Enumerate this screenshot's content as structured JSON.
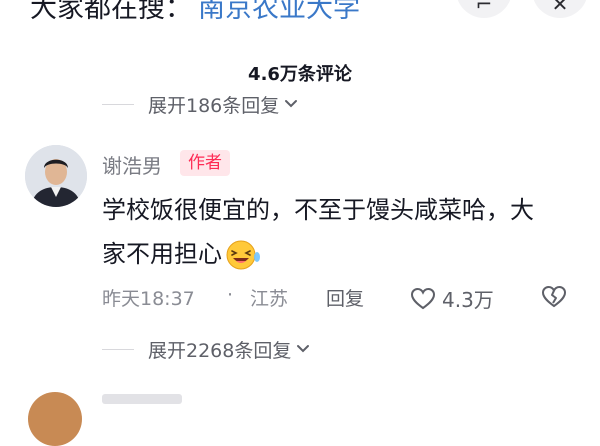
{
  "search_bar": {
    "prefix": "大家都在搜：",
    "keyword": "南京农业大学",
    "action_icon_1": "share-icon",
    "action_icon_2": "close-icon"
  },
  "comments_header": {
    "count_label": "4.6万条评论"
  },
  "expand_previous": {
    "label": "展开186条回复"
  },
  "comment": {
    "author": "谢浩男",
    "badge": "作者",
    "text": "学校饭很便宜的，不至于馒头咸菜哈，大家不用担心",
    "time": "昨天18:37",
    "separator": "·",
    "location": "江苏",
    "reply_label": "回复",
    "like_count": "4.3万",
    "emoji": "laughing-face-icon"
  },
  "expand_replies": {
    "label": "展开2268条回复"
  },
  "colors": {
    "keyword": "#3a78c8",
    "badge_text": "#fe2c55",
    "badge_bg": "#ffe6ea",
    "secondary_text": "#8a8c94"
  }
}
